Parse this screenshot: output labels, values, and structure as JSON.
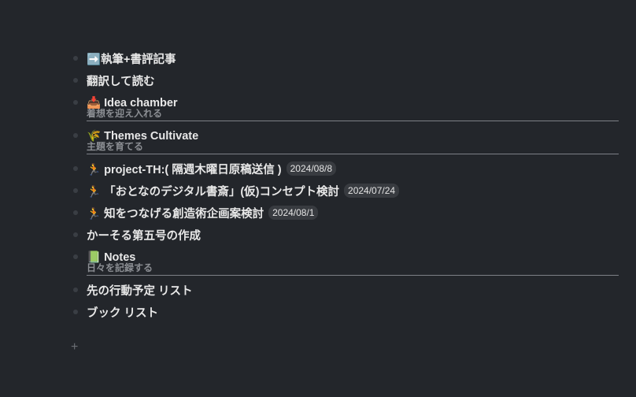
{
  "items": [
    {
      "icon": "arrow-right-icon",
      "label": "➡️執筆+書評記事"
    },
    {
      "icon": "",
      "label": "翻訳して読む"
    },
    {
      "icon": "inbox-tray-icon",
      "label": "📥 Idea chamber",
      "subtitle": "着想を迎え入れる"
    },
    {
      "icon": "rice-sheaf-icon",
      "label": "🌾 Themes Cultivate",
      "subtitle": "主題を育てる"
    },
    {
      "icon": "runner-icon",
      "label": "🏃 project-TH:( 隔週木曜日原稿送信 )",
      "date": "2024/08/8"
    },
    {
      "icon": "runner-icon",
      "label": "🏃 「おとなのデジタル書斎」(仮)コンセプト検討",
      "date": "2024/07/24"
    },
    {
      "icon": "runner-icon",
      "label": "🏃 知をつなげる創造術企画案検討",
      "date": "2024/08/1"
    },
    {
      "icon": "",
      "label": "かーそる第五号の作成"
    },
    {
      "icon": "green-book-icon",
      "label": "📗 Notes",
      "subtitle": "日々を記録する"
    },
    {
      "icon": "",
      "label": "先の行動予定 リスト"
    },
    {
      "icon": "",
      "label": "ブック リスト"
    }
  ],
  "add_button": "+"
}
